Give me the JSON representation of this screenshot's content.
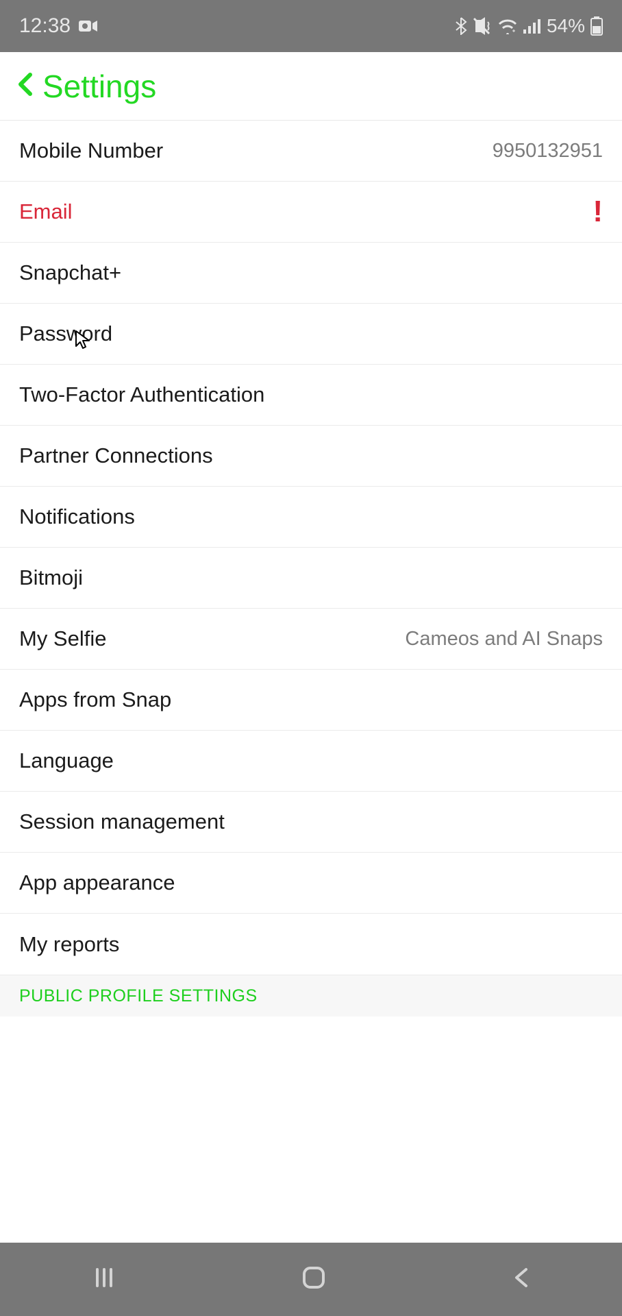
{
  "statusbar": {
    "time": "12:38",
    "battery_text": "54%"
  },
  "header": {
    "title": "Settings"
  },
  "rows": {
    "mobile_number": {
      "label": "Mobile Number",
      "value": "9950132951"
    },
    "email": {
      "label": "Email"
    },
    "snapchat_plus": {
      "label": "Snapchat+"
    },
    "password": {
      "label": "Password"
    },
    "two_factor": {
      "label": "Two-Factor Authentication"
    },
    "partner_conn": {
      "label": "Partner Connections"
    },
    "notifications": {
      "label": "Notifications"
    },
    "bitmoji": {
      "label": "Bitmoji"
    },
    "my_selfie": {
      "label": "My Selfie",
      "value": "Cameos and AI Snaps"
    },
    "apps_from_snap": {
      "label": "Apps from Snap"
    },
    "language": {
      "label": "Language"
    },
    "session_mgmt": {
      "label": "Session management"
    },
    "app_appearance": {
      "label": "App appearance"
    },
    "my_reports": {
      "label": "My reports"
    }
  },
  "sections": {
    "public_profile": "PUBLIC PROFILE SETTINGS"
  }
}
